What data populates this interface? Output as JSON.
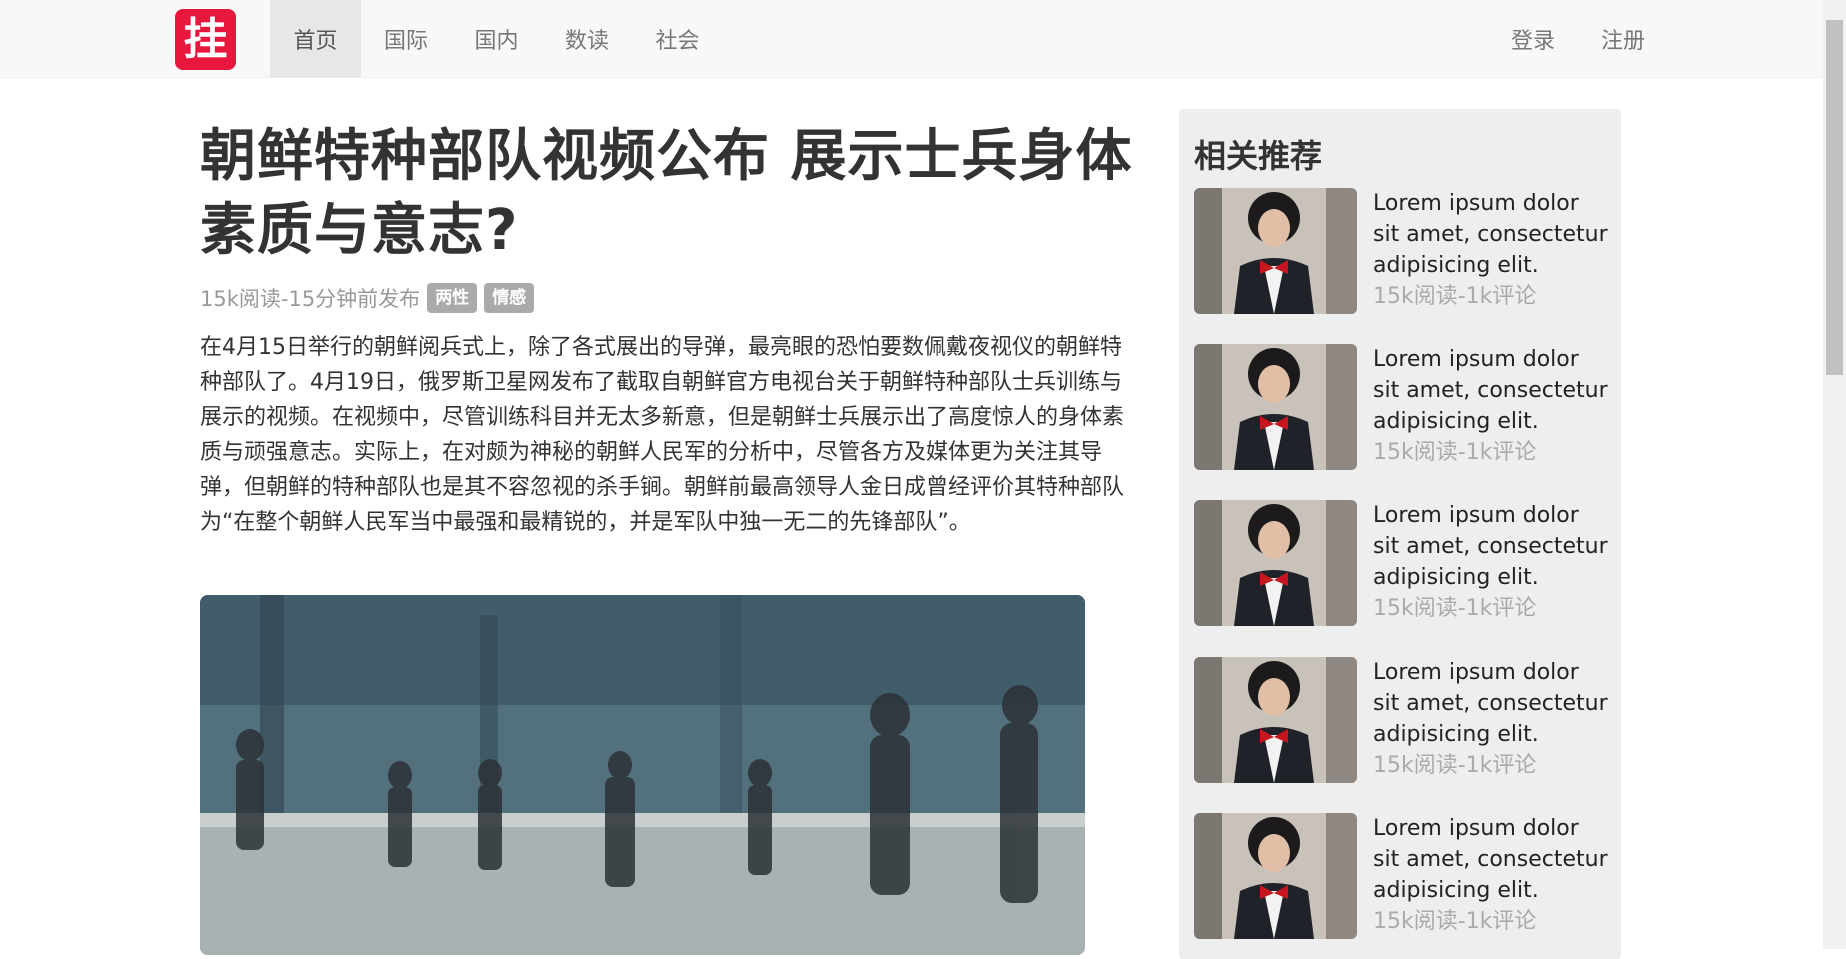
{
  "navbar": {
    "logo_text": "挂",
    "items": [
      {
        "label": "首页",
        "active": true
      },
      {
        "label": "国际",
        "active": false
      },
      {
        "label": "国内",
        "active": false
      },
      {
        "label": "数读",
        "active": false
      },
      {
        "label": "社会",
        "active": false
      }
    ],
    "login": "登录",
    "register": "注册"
  },
  "article": {
    "title": "朝鲜特种部队视频公布 展示士兵身体素质与意志?",
    "meta": "15k阅读-15分钟前发布",
    "tags": [
      "两性",
      "情感"
    ],
    "body": "在4月15日举行的朝鲜阅兵式上，除了各式展出的导弹，最亮眼的恐怕要数佩戴夜视仪的朝鲜特种部队了。4月19日，俄罗斯卫星网发布了截取自朝鲜官方电视台关于朝鲜特种部队士兵训练与展示的视频。在视频中，尽管训练科目并无太多新意，但是朝鲜士兵展示出了高度惊人的身体素质与顽强意志。实际上，在对颇为神秘的朝鲜人民军的分析中，尽管各方及媒体更为关注其导弹，但朝鲜的特种部队也是其不容忽视的杀手锏。朝鲜前最高领导人金日成曾经评价其特种部队为“在整个朝鲜人民军当中最强和最精锐的，并是军队中独一无二的先锋部队”。"
  },
  "sidebar": {
    "title": "相关推荐",
    "items": [
      {
        "text": "Lorem ipsum dolor sit amet, consectetur adipisicing elit.",
        "meta": "15k阅读-1k评论"
      },
      {
        "text": "Lorem ipsum dolor sit amet, consectetur adipisicing elit.",
        "meta": "15k阅读-1k评论"
      },
      {
        "text": "Lorem ipsum dolor sit amet, consectetur adipisicing elit.",
        "meta": "15k阅读-1k评论"
      },
      {
        "text": "Lorem ipsum dolor sit amet, consectetur adipisicing elit.",
        "meta": "15k阅读-1k评论"
      },
      {
        "text": "Lorem ipsum dolor sit amet, consectetur adipisicing elit.",
        "meta": "15k阅读-1k评论"
      }
    ]
  },
  "colors": {
    "brand": "#e8173e",
    "nav_bg": "#f8f8f8",
    "sidebar_bg": "#eeeeee",
    "tag_bg": "#aaaaaa"
  }
}
